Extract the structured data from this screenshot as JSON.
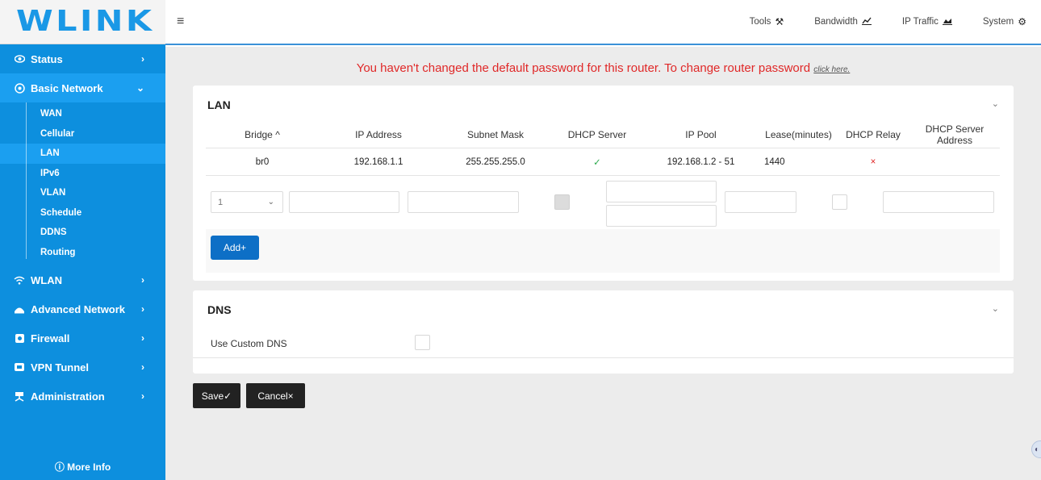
{
  "brand": {
    "logo": "WLINK",
    "color": "#1a98e6"
  },
  "sidebar": {
    "bg_color": "#0d8fde",
    "items": [
      {
        "label": "Status",
        "icon": "eye-icon",
        "arrow": "›"
      },
      {
        "label": "Basic Network",
        "icon": "globe-icon",
        "arrow": "⌄",
        "expanded": true
      },
      {
        "label": "WLAN",
        "icon": "wifi-icon",
        "arrow": "›"
      },
      {
        "label": "Advanced Network",
        "icon": "router-icon",
        "arrow": "›"
      },
      {
        "label": "Firewall",
        "icon": "firewall-icon",
        "arrow": "›"
      },
      {
        "label": "VPN Tunnel",
        "icon": "vpn-icon",
        "arrow": "›"
      },
      {
        "label": "Administration",
        "icon": "admin-icon",
        "arrow": "›"
      }
    ],
    "subitems": [
      "WAN",
      "Cellular",
      "LAN",
      "IPv6",
      "VLAN",
      "Schedule",
      "DDNS",
      "Routing"
    ],
    "current_subitem": "LAN",
    "more_info": "More Info"
  },
  "topbar": {
    "menu_icon": "hamburger-icon",
    "links": [
      {
        "label": "Tools",
        "icon": "tools-icon"
      },
      {
        "label": "Bandwidth",
        "icon": "chart-line-icon"
      },
      {
        "label": "IP Traffic",
        "icon": "chart-area-icon"
      },
      {
        "label": "System",
        "icon": "gear-icon"
      }
    ]
  },
  "warning": {
    "text": "You haven't changed the default password for this router. To change router password",
    "link": "click here.",
    "color": "#e02828"
  },
  "lan": {
    "title": "LAN",
    "columns": [
      "Bridge ^",
      "IP Address",
      "Subnet Mask",
      "DHCP Server",
      "IP Pool",
      "Lease(minutes)",
      "DHCP Relay",
      "DHCP Server Address"
    ],
    "rows": [
      {
        "bridge": "br0",
        "ip": "192.168.1.1",
        "mask": "255.255.255.0",
        "dhcp_server": "✓",
        "pool": "192.168.1.2 - 51",
        "lease": "1440",
        "relay": "×",
        "server_address": ""
      }
    ],
    "new_row": {
      "bridge_select": "1"
    },
    "add_label": "Add+"
  },
  "dns": {
    "title": "DNS",
    "custom_label": "Use Custom DNS"
  },
  "actions": {
    "save": "Save✓",
    "cancel": "Cancel×"
  }
}
